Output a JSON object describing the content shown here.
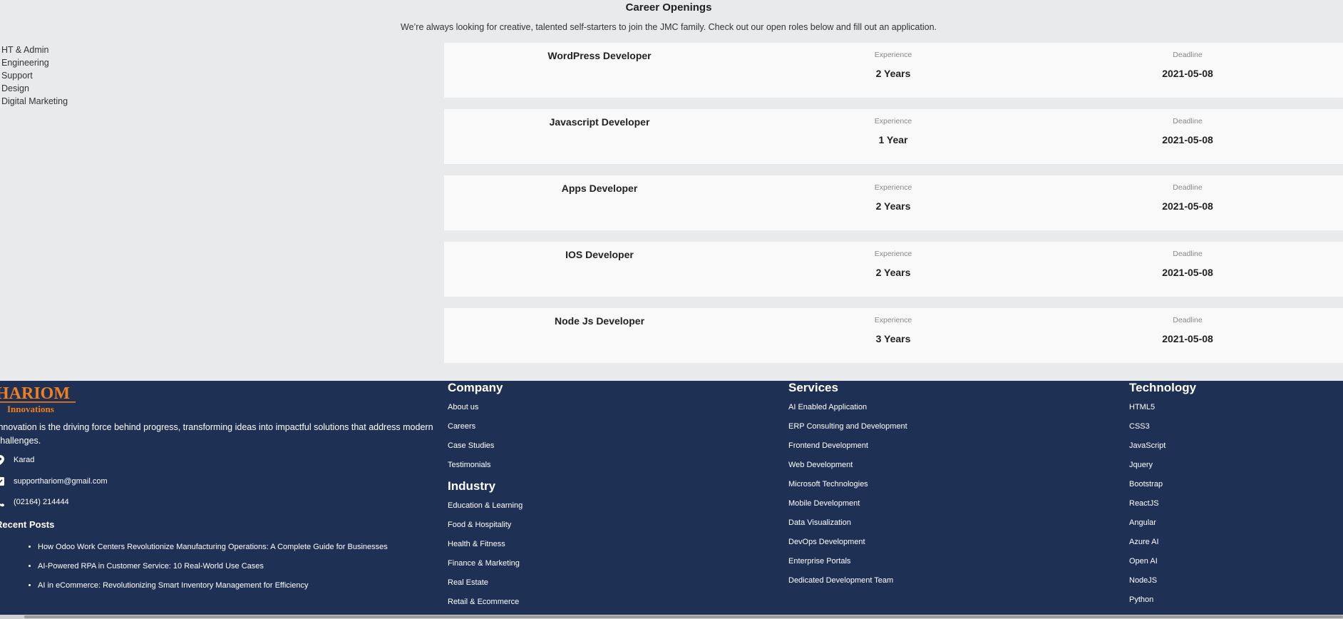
{
  "careers": {
    "title": "Career Openings",
    "subtitle": "We’re always looking for creative, talented self-starters to join the JMC family. Check out our open roles below and fill out an application.",
    "categories": [
      "HT & Admin",
      "Engineering",
      "Support",
      "Design",
      "Digital Marketing"
    ],
    "experience_label": "Experience",
    "deadline_label": "Deadline",
    "jobs": [
      {
        "title": "WordPress Developer",
        "experience": "2 Years",
        "deadline": "2021-05-08"
      },
      {
        "title": "Javascript Developer",
        "experience": "1 Year",
        "deadline": "2021-05-08"
      },
      {
        "title": "Apps Developer",
        "experience": "2 Years",
        "deadline": "2021-05-08"
      },
      {
        "title": "IOS Developer",
        "experience": "2 Years",
        "deadline": "2021-05-08"
      },
      {
        "title": "Node Js Developer",
        "experience": "3 Years",
        "deadline": "2021-05-08"
      }
    ]
  },
  "footer": {
    "logo": {
      "main": "HARIOM",
      "sub": "Innovations"
    },
    "tagline": "Innovation is the driving force behind progress, transforming ideas into impactful solutions that address modern challenges.",
    "contact": {
      "location": "Karad",
      "email": "supporthariom@gmail.com",
      "phone": "(02164) 214444"
    },
    "recent_posts_title": "Recent Posts",
    "recent_posts": [
      "How Odoo Work Centers Revolutionize Manufacturing Operations: A Complete Guide for Businesses",
      "AI-Powered RPA in Customer Service: 10 Real-World Use Cases",
      "AI in eCommerce: Revolutionizing Smart Inventory Management for Efficiency"
    ],
    "company": {
      "title": "Company",
      "links": [
        "About us",
        "Careers",
        "Case Studies",
        "Testimonials"
      ]
    },
    "industry": {
      "title": "Industry",
      "links": [
        "Education & Learning",
        "Food & Hospitality",
        "Health & Fitness",
        "Finance & Marketing",
        "Real Estate",
        "Retail & Ecommerce"
      ]
    },
    "services": {
      "title": "Services",
      "links": [
        "AI Enabled Application",
        "ERP Consulting and Development",
        "Frontend Development",
        "Web Development",
        "Microsoft Technologies",
        "Mobile Development",
        "Data Visualization",
        "DevOps Development",
        "Enterprise Portals",
        "Dedicated Development Team"
      ]
    },
    "technology": {
      "title": "Technology",
      "links": [
        "HTML5",
        "CSS3",
        "JavaScript",
        "Jquery",
        "Bootstrap",
        "ReactJS",
        "Angular",
        "Azure AI",
        "Open AI",
        "NodeJS",
        "Python"
      ]
    },
    "colors": {
      "background": "#1e3154",
      "logo_accent": "#f07f1e"
    },
    "icons": {
      "location": "map-pin-icon",
      "email": "envelope-icon",
      "phone": "phone-icon"
    }
  }
}
